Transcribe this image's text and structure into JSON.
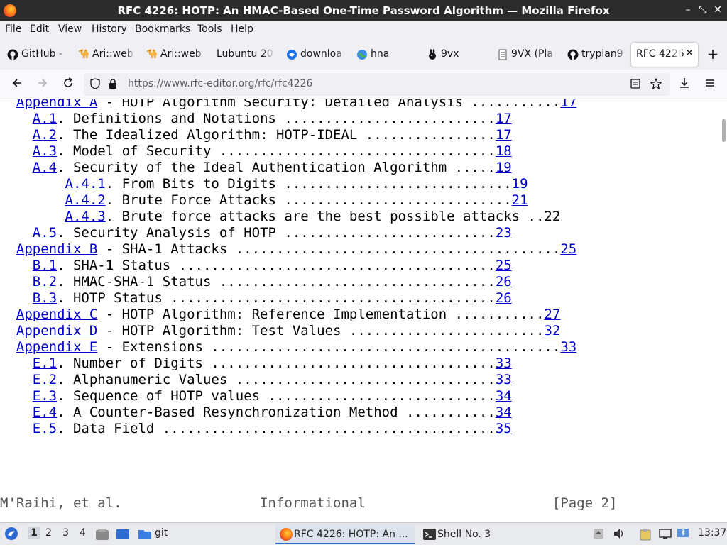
{
  "window": {
    "title": "RFC 4226: HOTP: An HMAC-Based One-Time Password Algorithm — Mozilla Firefox",
    "controls": [
      "–",
      "⤡",
      "✕"
    ]
  },
  "menubar": {
    "items": [
      {
        "label": "File"
      },
      {
        "label": "Edit"
      },
      {
        "label": "View"
      },
      {
        "label": "History"
      },
      {
        "label": "Bookmarks"
      },
      {
        "label": "Tools"
      },
      {
        "label": "Help"
      }
    ]
  },
  "tabs": [
    {
      "label": "GitHub -",
      "icon": "github-icon"
    },
    {
      "label": "Ari::web",
      "icon": "camel-icon"
    },
    {
      "label": "Ari::web",
      "icon": "camel-icon"
    },
    {
      "label": "Lubuntu 20",
      "icon": "none"
    },
    {
      "label": "downloa",
      "icon": "download-icon"
    },
    {
      "label": "hna",
      "icon": "globe-icon"
    },
    {
      "label": "9vx",
      "icon": "bunny-icon"
    },
    {
      "label": "9VX (Pla",
      "icon": "page-icon"
    },
    {
      "label": "tryplan9",
      "icon": "github-icon"
    },
    {
      "label": "RFC 4226",
      "icon": "none",
      "active": true
    }
  ],
  "new_tab_glyph": "+",
  "urlbar": {
    "url": "https://www.rfc-editor.org/rfc/rfc4226"
  },
  "toc": {
    "lines": [
      {
        "indent": "  ",
        "link": "Appendix A",
        "rest": " - HOTP Algorithm Security: Detailed Analysis ...........",
        "page": "17"
      },
      {
        "indent": "    ",
        "link": "A.1",
        "rest": ". Definitions and Notations ..........................",
        "page": "17"
      },
      {
        "indent": "    ",
        "link": "A.2",
        "rest": ". The Idealized Algorithm: HOTP-IDEAL ................",
        "page": "17"
      },
      {
        "indent": "    ",
        "link": "A.3",
        "rest": ". Model of Security ..................................",
        "page": "18"
      },
      {
        "indent": "    ",
        "link": "A.4",
        "rest": ". Security of the Ideal Authentication Algorithm .....",
        "page": "19"
      },
      {
        "indent": "        ",
        "link": "A.4.1",
        "rest": ". From Bits to Digits ............................",
        "page": "19"
      },
      {
        "indent": "        ",
        "link": "A.4.2",
        "rest": ". Brute Force Attacks ............................",
        "page": "21"
      },
      {
        "indent": "        ",
        "link": "A.4.3",
        "rest": ". Brute force attacks are the best possible attacks ..22",
        "page": ""
      },
      {
        "indent": "    ",
        "link": "A.5",
        "rest": ". Security Analysis of HOTP ..........................",
        "page": "23"
      },
      {
        "indent": "  ",
        "link": "Appendix B",
        "rest": " - SHA-1 Attacks ........................................",
        "page": "25"
      },
      {
        "indent": "    ",
        "link": "B.1",
        "rest": ". SHA-1 Status .......................................",
        "page": "25"
      },
      {
        "indent": "    ",
        "link": "B.2",
        "rest": ". HMAC-SHA-1 Status ..................................",
        "page": "26"
      },
      {
        "indent": "    ",
        "link": "B.3",
        "rest": ". HOTP Status ........................................",
        "page": "26"
      },
      {
        "indent": "  ",
        "link": "Appendix C",
        "rest": " - HOTP Algorithm: Reference Implementation ...........",
        "page": "27"
      },
      {
        "indent": "  ",
        "link": "Appendix D",
        "rest": " - HOTP Algorithm: Test Values ........................",
        "page": "32"
      },
      {
        "indent": "  ",
        "link": "Appendix E",
        "rest": " - Extensions ...........................................",
        "page": "33"
      },
      {
        "indent": "    ",
        "link": "E.1",
        "rest": ". Number of Digits ...................................",
        "page": "33"
      },
      {
        "indent": "    ",
        "link": "E.2",
        "rest": ". Alphanumeric Values ................................",
        "page": "33"
      },
      {
        "indent": "    ",
        "link": "E.3",
        "rest": ". Sequence of HOTP values ............................",
        "page": "34"
      },
      {
        "indent": "    ",
        "link": "E.4",
        "rest": ". A Counter-Based Resynchronization Method ...........",
        "page": "34"
      },
      {
        "indent": "    ",
        "link": "E.5",
        "rest": ". Data Field .........................................",
        "page": "35"
      }
    ]
  },
  "page_footer": {
    "author": "M'Raihi, et al.",
    "category": "Informational",
    "page": "[Page 2]"
  },
  "taskbar": {
    "workspaces": [
      "1",
      "2",
      "3",
      "4"
    ],
    "folder_label": "git",
    "tasks": [
      {
        "label": "RFC 4226: HOTP: An ...",
        "icon": "firefox-icon",
        "active": true
      },
      {
        "label": "Shell No. 3",
        "icon": "terminal-icon",
        "active": false
      }
    ],
    "clock": "13:37"
  },
  "colors": {
    "link": "#0000cc",
    "titlebar_bg": "#2b2b2b",
    "taskbar_accent": "#2d6bd3"
  }
}
